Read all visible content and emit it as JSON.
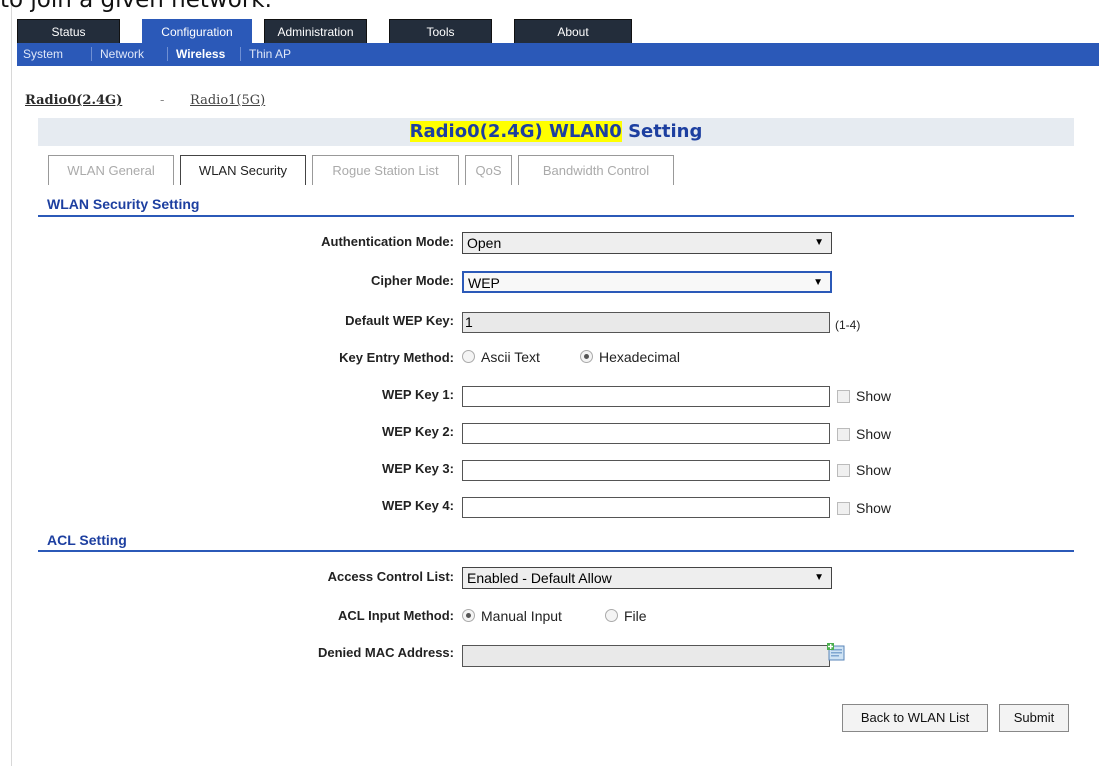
{
  "caption": "to join a given network.",
  "top_tabs": [
    "Status",
    "Configuration",
    "Administration",
    "Tools",
    "About"
  ],
  "sub_nav": [
    "System",
    "Network",
    "Wireless",
    "Thin AP"
  ],
  "radio_links": {
    "radio0": "Radio0(2.4G)",
    "sep": "-",
    "radio1": "Radio1(5G)"
  },
  "title": {
    "highlight": "Radio0(2.4G) WLAN0",
    "rest": " Setting"
  },
  "page_tabs": [
    "WLAN General",
    "WLAN Security",
    "Rogue Station List",
    "QoS",
    "Bandwidth Control"
  ],
  "security": {
    "section_title": "WLAN Security Setting",
    "auth_mode_label": "Authentication Mode:",
    "auth_mode_value": "Open",
    "cipher_mode_label": "Cipher Mode:",
    "cipher_mode_value": "WEP",
    "default_key_label": "Default WEP Key:",
    "default_key_value": "1",
    "default_key_hint": "(1-4)",
    "key_entry_label": "Key Entry Method:",
    "key_entry_opt1": "Ascii Text",
    "key_entry_opt2": "Hexadecimal",
    "key1_label": "WEP Key 1:",
    "key2_label": "WEP Key 2:",
    "key3_label": "WEP Key 3:",
    "key4_label": "WEP Key 4:",
    "show_label": "Show"
  },
  "acl": {
    "section_title": "ACL Setting",
    "list_label": "Access Control List:",
    "list_value": "Enabled - Default Allow",
    "input_method_label": "ACL Input Method:",
    "input_opt1": "Manual Input",
    "input_opt2": "File",
    "denied_label": "Denied MAC Address:"
  },
  "buttons": {
    "back": "Back to WLAN List",
    "submit": "Submit"
  },
  "colors": {
    "nav_dark": "#232d3b",
    "accent_blue": "#2b59b8",
    "title_highlight": "#ffff00"
  }
}
